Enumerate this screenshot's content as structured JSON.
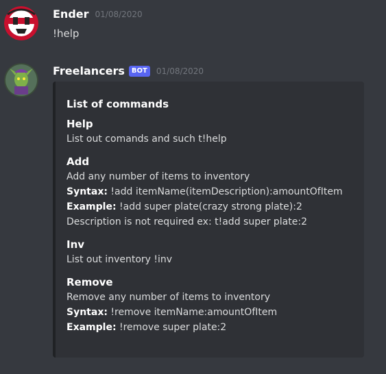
{
  "messages": [
    {
      "username": "Ender",
      "timestamp": "01/08/2020",
      "text": "!help",
      "avatar_icon": "red-robot-avatar"
    },
    {
      "username": "Freelancers",
      "bot_tag": "BOT",
      "timestamp": "01/08/2020",
      "avatar_icon": "green-goblin-avatar",
      "embed": {
        "title": "List of commands",
        "fields": [
          {
            "name": "Help",
            "lines": [
              {
                "label": "",
                "text": "List out comands and such t!help"
              }
            ]
          },
          {
            "name": "Add",
            "lines": [
              {
                "label": "",
                "text": "Add any number of items to inventory"
              },
              {
                "label": "Syntax:",
                "text": " !add itemName(itemDescription):amountOfItem"
              },
              {
                "label": "Example:",
                "text": " !add super plate(crazy strong plate):2"
              },
              {
                "label": "",
                "text": "Description is not required ex: t!add super plate:2"
              }
            ]
          },
          {
            "name": "Inv",
            "lines": [
              {
                "label": "",
                "text": "List out inventory !inv"
              }
            ]
          },
          {
            "name": "Remove",
            "lines": [
              {
                "label": "",
                "text": "Remove any number of items to inventory"
              },
              {
                "label": "Syntax:",
                "text": " !remove itemName:amountOfItem"
              },
              {
                "label": "Example:",
                "text": " !remove super plate:2"
              }
            ]
          }
        ]
      }
    }
  ],
  "colors": {
    "background": "#36393f",
    "embed_background": "#2f3136",
    "embed_border": "#202225",
    "bot_tag": "#5865f2",
    "timestamp": "#72767d"
  }
}
